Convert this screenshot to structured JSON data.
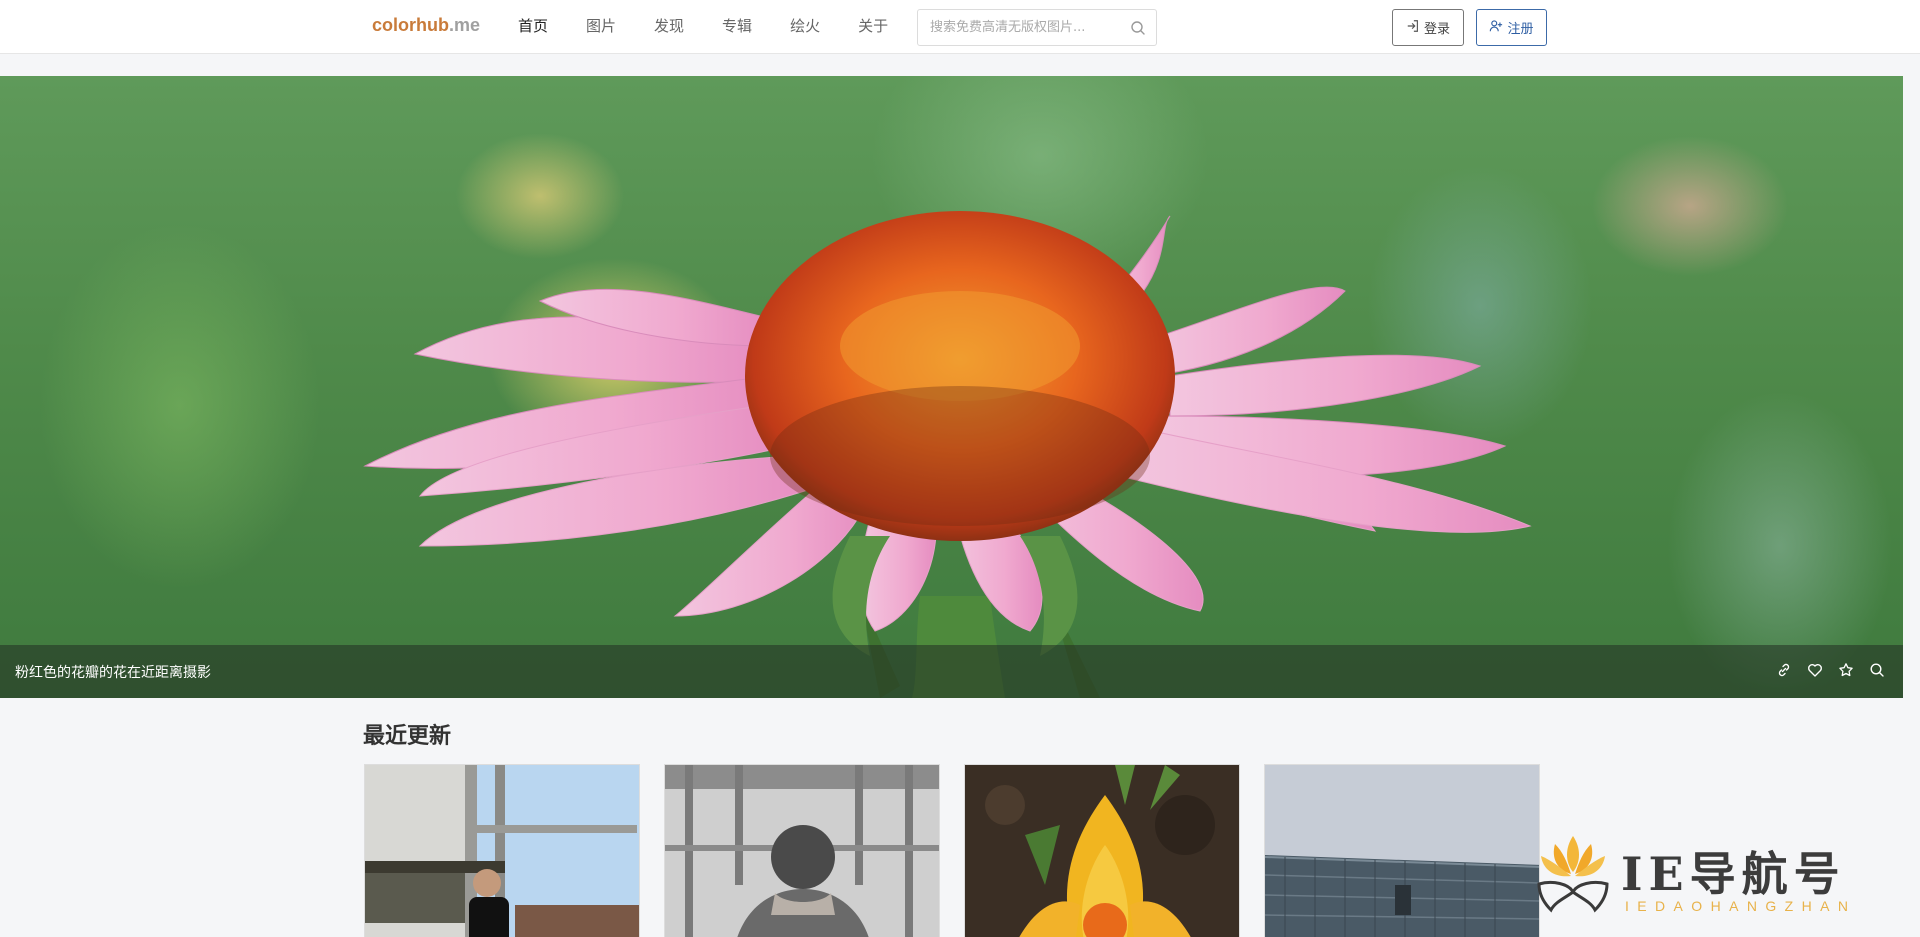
{
  "header": {
    "logo_main": "colorhub",
    "logo_suffix": ".me",
    "nav": [
      {
        "label": "首页",
        "active": true
      },
      {
        "label": "图片",
        "active": false
      },
      {
        "label": "发现",
        "active": false
      },
      {
        "label": "专辑",
        "active": false
      },
      {
        "label": "绘火",
        "active": false
      },
      {
        "label": "关于",
        "active": false
      }
    ],
    "search_placeholder": "搜索免费高清无版权图片...",
    "login_label": "登录",
    "register_label": "注册"
  },
  "hero": {
    "caption": "粉红色的花瓣的花在近距离摄影",
    "icons": [
      "link-icon",
      "heart-icon",
      "star-icon",
      "search-icon"
    ]
  },
  "recent": {
    "title": "最近更新"
  },
  "watermark": {
    "text": "IE导航号",
    "sub": "IEDAOHANGZHAN"
  },
  "colors": {
    "logo": "#c97b3a",
    "register": "#2e5ea3"
  }
}
